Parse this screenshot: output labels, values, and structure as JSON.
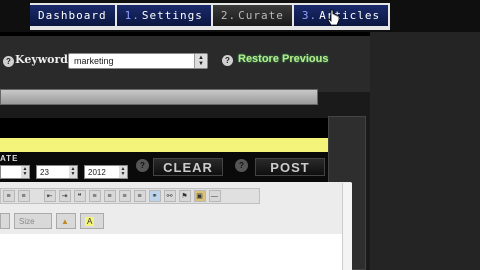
{
  "nav": {
    "tabs": [
      {
        "num": "",
        "label": "Dashboard"
      },
      {
        "num": "1.",
        "label": "Settings"
      },
      {
        "num": "2.",
        "label": "Curate"
      },
      {
        "num": "3.",
        "label": "Articles"
      }
    ]
  },
  "keyword_bar": {
    "label": "Keyword :",
    "value": "marketing",
    "restore": "Restore Previous"
  },
  "schedule": {
    "date_label": "ATE",
    "day": "23",
    "year": "2012",
    "clear": "CLEAR",
    "post": "POST"
  },
  "editor": {
    "size_label": "Size",
    "font_color": "A"
  },
  "colors": {
    "accent_yellow": "#f5f47a",
    "nav_blue": "#0b1640",
    "restore_green": "#bfe88b"
  }
}
